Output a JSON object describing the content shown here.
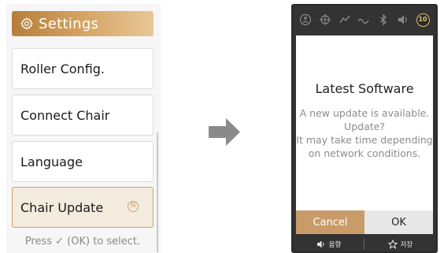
{
  "settings": {
    "title": "Settings",
    "icon": "gear-icon",
    "menu_items": [
      {
        "label": "Roller Config."
      },
      {
        "label": "Connect Chair"
      },
      {
        "label": "Language"
      },
      {
        "label": "Chair Update",
        "selected": true,
        "badge": "N"
      }
    ],
    "hint": "Press ✓ (OK) to select."
  },
  "transition_icon": "right-arrow-icon",
  "device": {
    "status_icons": [
      "person-icon",
      "target-icon",
      "airbag-icon",
      "wave-icon",
      "bluetooth-icon",
      "speaker-icon"
    ],
    "timer_value": "10",
    "dialog": {
      "title": "Latest Software",
      "body_lines": [
        "A new update is available.",
        "Update?",
        "It may take time depending",
        "on network conditions."
      ],
      "cancel_label": "Cancel",
      "ok_label": "OK"
    },
    "footer": {
      "sound_label": "음향",
      "save_label": "저장"
    }
  },
  "colors": {
    "accent": "#c99b68",
    "selected_border": "#c9a173",
    "device_bg": "#333333"
  }
}
